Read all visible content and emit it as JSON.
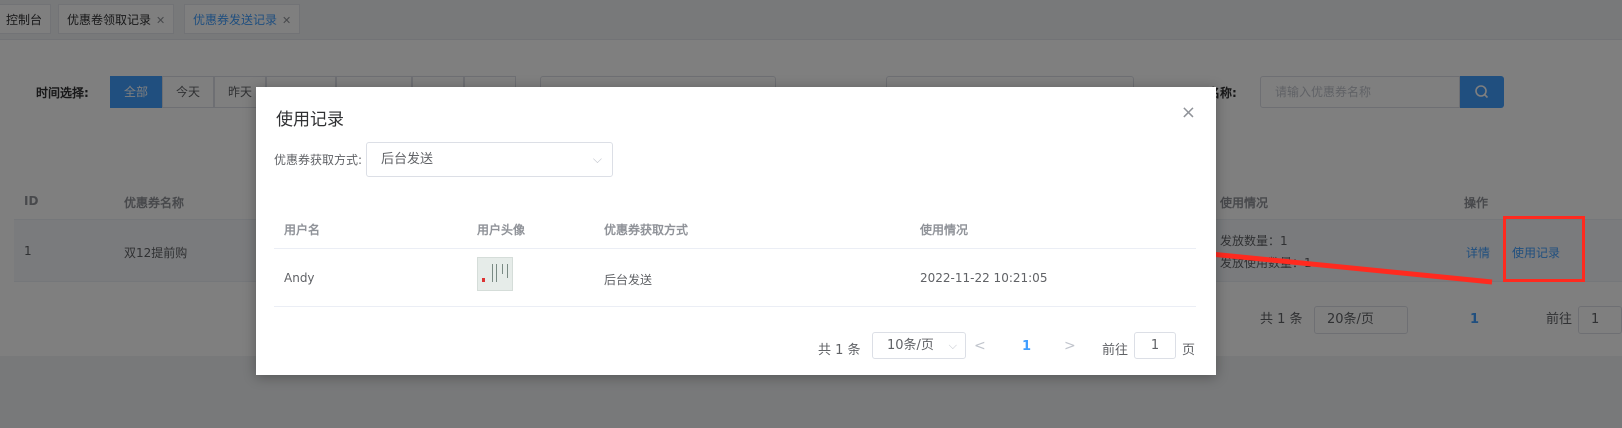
{
  "tabs": [
    {
      "label": "控制台",
      "closable": false
    },
    {
      "label": "优惠卷领取记录",
      "closable": true
    },
    {
      "label": "优惠券发送记录",
      "closable": true,
      "active": true
    }
  ],
  "filter": {
    "time_label": "时间选择:",
    "segments": [
      "全部",
      "今天",
      "昨天"
    ],
    "name_label": "名称:",
    "name_placeholder": "请输入优惠券名称"
  },
  "table": {
    "headers": {
      "id": "ID",
      "name": "优惠券名称",
      "usage": "使用情况",
      "action": "操作"
    },
    "rows": [
      {
        "id": "1",
        "name": "双12提前购",
        "issued": "发放数量：1",
        "used": "发放使用数量：1",
        "detail": "详情",
        "records": "使用记录"
      }
    ]
  },
  "bg_pager": {
    "total": "共 1 条",
    "size": "20条/页",
    "page": "1",
    "goto": "前往",
    "goto_value": "1"
  },
  "dialog": {
    "title": "使用记录",
    "close": "×",
    "filter_label": "优惠券获取方式:",
    "filter_value": "后台发送",
    "headers": [
      "用户名",
      "用户头像",
      "优惠券获取方式",
      "使用情况"
    ],
    "rows": [
      {
        "username": "Andy",
        "method": "后台发送",
        "usage": "2022-11-22 10:21:05"
      }
    ],
    "pager": {
      "total": "共 1 条",
      "size": "10条/页",
      "prev": "<",
      "page": "1",
      "next": ">",
      "goto": "前往",
      "goto_value": "1",
      "page_unit": "页"
    }
  },
  "colors": {
    "primary": "#409eff",
    "annotation": "#ff2a1f"
  },
  "icons": [
    "close-icon",
    "chevron-down-icon",
    "search-icon",
    "chevron-left-icon",
    "chevron-right-icon"
  ]
}
